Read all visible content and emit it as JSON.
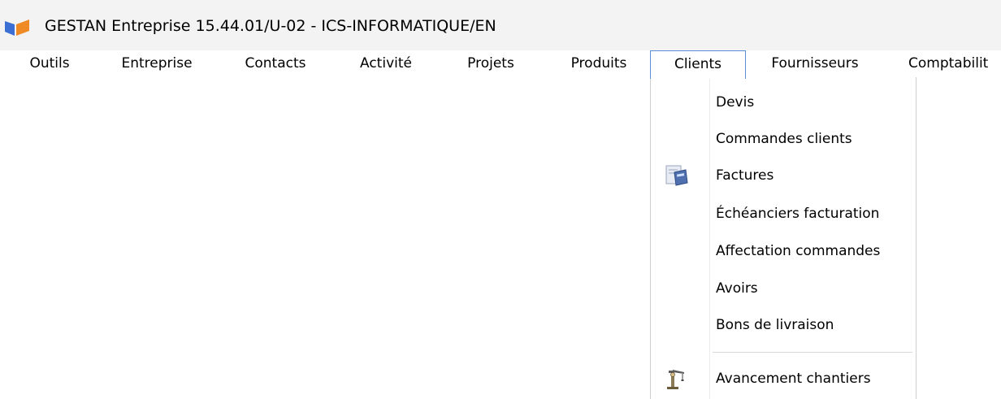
{
  "window": {
    "title": "GESTAN Entreprise 15.44.01/U-02 - ICS-INFORMATIQUE/EN"
  },
  "menubar": {
    "items": [
      {
        "label": "Outils"
      },
      {
        "label": "Entreprise"
      },
      {
        "label": "Contacts"
      },
      {
        "label": "Activité"
      },
      {
        "label": "Projets"
      },
      {
        "label": "Produits"
      },
      {
        "label": "Clients"
      },
      {
        "label": "Fournisseurs"
      },
      {
        "label": "Comptabilit"
      }
    ],
    "open_item": "Clients"
  },
  "dropdown": {
    "items": [
      {
        "label": "Devis",
        "icon": ""
      },
      {
        "label": "Commandes clients",
        "icon": ""
      },
      {
        "label": "Factures",
        "icon": "invoice-calculator-icon"
      },
      {
        "label": "Échéanciers facturation",
        "icon": ""
      },
      {
        "label": "Affectation commandes",
        "icon": ""
      },
      {
        "label": "Avoirs",
        "icon": ""
      },
      {
        "label": "Bons de livraison",
        "icon": ""
      },
      {
        "label": "Avancement chantiers",
        "icon": "construction-crane-icon"
      }
    ]
  },
  "colors": {
    "titlebar_bg": "#f3f3f3",
    "open_menu_border": "#5a8fd8",
    "logo_blue": "#3b6fd4",
    "logo_orange": "#f08a24"
  }
}
